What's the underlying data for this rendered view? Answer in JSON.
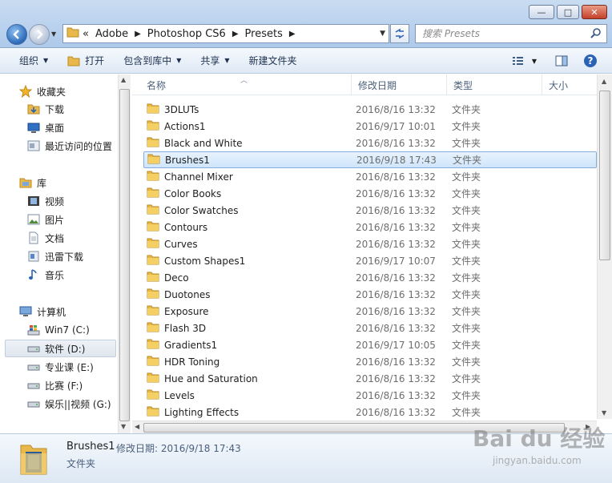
{
  "window": {
    "min_label": "—",
    "max_label": "□",
    "close_label": "✕"
  },
  "address": {
    "prefix": "«",
    "crumbs": [
      "Adobe",
      "Photoshop CS6",
      "Presets"
    ]
  },
  "search": {
    "placeholder": "搜索 Presets"
  },
  "toolbar": {
    "organize": "组织",
    "open": "打开",
    "include_library": "包含到库中",
    "share": "共享",
    "new_folder": "新建文件夹"
  },
  "nav": {
    "favorites": "收藏夹",
    "downloads": "下载",
    "desktop": "桌面",
    "recent": "最近访问的位置",
    "libraries": "库",
    "videos": "视频",
    "pictures": "图片",
    "documents": "文档",
    "thunder": "迅雷下载",
    "music": "音乐",
    "computer": "计算机",
    "drives": [
      "Win7 (C:)",
      "软件 (D:)",
      "专业课 (E:)",
      "比赛 (F:)",
      "娱乐||视频 (G:)"
    ]
  },
  "columns": {
    "name": "名称",
    "date": "修改日期",
    "type": "类型",
    "size": "大小"
  },
  "files": [
    {
      "name": "3DLUTs",
      "date": "2016/8/16 13:32",
      "type": "文件夹"
    },
    {
      "name": "Actions1",
      "date": "2016/9/17 10:01",
      "type": "文件夹"
    },
    {
      "name": "Black and White",
      "date": "2016/8/16 13:32",
      "type": "文件夹"
    },
    {
      "name": "Brushes1",
      "date": "2016/9/18 17:43",
      "type": "文件夹"
    },
    {
      "name": "Channel Mixer",
      "date": "2016/8/16 13:32",
      "type": "文件夹"
    },
    {
      "name": "Color Books",
      "date": "2016/8/16 13:32",
      "type": "文件夹"
    },
    {
      "name": "Color Swatches",
      "date": "2016/8/16 13:32",
      "type": "文件夹"
    },
    {
      "name": "Contours",
      "date": "2016/8/16 13:32",
      "type": "文件夹"
    },
    {
      "name": "Curves",
      "date": "2016/8/16 13:32",
      "type": "文件夹"
    },
    {
      "name": "Custom Shapes1",
      "date": "2016/9/17 10:07",
      "type": "文件夹"
    },
    {
      "name": "Deco",
      "date": "2016/8/16 13:32",
      "type": "文件夹"
    },
    {
      "name": "Duotones",
      "date": "2016/8/16 13:32",
      "type": "文件夹"
    },
    {
      "name": "Exposure",
      "date": "2016/8/16 13:32",
      "type": "文件夹"
    },
    {
      "name": "Flash 3D",
      "date": "2016/8/16 13:32",
      "type": "文件夹"
    },
    {
      "name": "Gradients1",
      "date": "2016/9/17 10:05",
      "type": "文件夹"
    },
    {
      "name": "HDR Toning",
      "date": "2016/8/16 13:32",
      "type": "文件夹"
    },
    {
      "name": "Hue and Saturation",
      "date": "2016/8/16 13:32",
      "type": "文件夹"
    },
    {
      "name": "Levels",
      "date": "2016/8/16 13:32",
      "type": "文件夹"
    },
    {
      "name": "Lighting Effects",
      "date": "2016/8/16 13:32",
      "type": "文件夹"
    }
  ],
  "selected_index": 3,
  "details": {
    "name": "Brushes1",
    "meta": "修改日期: 2016/9/18 17:43",
    "type": "文件夹"
  },
  "watermark": {
    "brand": "Bai du 经验",
    "url": "jingyan.baidu.com"
  },
  "colors": {
    "folder": "#e8b94a",
    "selection": "#cfe5fb",
    "accent": "#2a62b5"
  }
}
